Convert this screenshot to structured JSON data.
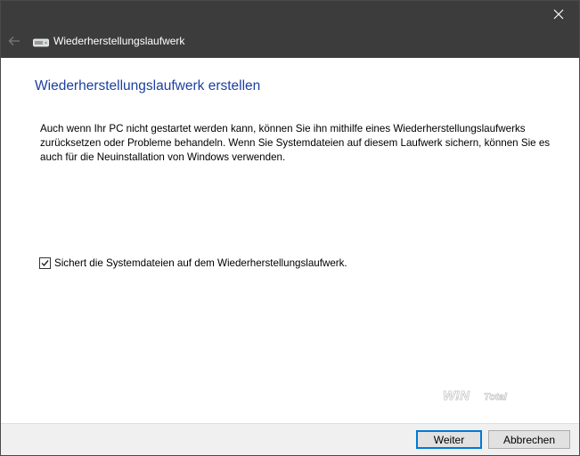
{
  "window": {
    "title": "Wiederherstellungslaufwerk",
    "title_icon": "drive-icon",
    "back_icon": "back-arrow-icon",
    "close_icon": "close-icon"
  },
  "main": {
    "heading": "Wiederherstellungslaufwerk erstellen",
    "description": "Auch wenn Ihr PC nicht gestartet werden kann, können Sie ihn mithilfe eines Wiederherstellungslaufwerks zurücksetzen oder Probleme behandeln. Wenn Sie Systemdateien auf diesem Laufwerk sichern, können Sie es auch für die Neuinstallation von Windows verwenden.",
    "backup_option": {
      "label": "Sichert die Systemdateien auf dem Wiederherstellungslaufwerk.",
      "checked": true
    },
    "watermark": "WinTotal"
  },
  "footer": {
    "next_label": "Weiter",
    "cancel_label": "Abbrechen"
  },
  "colors": {
    "titlebar": "#3c3c3c",
    "heading": "#1c3fa0",
    "accent": "#0078d7",
    "footer": "#f0f0f0"
  }
}
